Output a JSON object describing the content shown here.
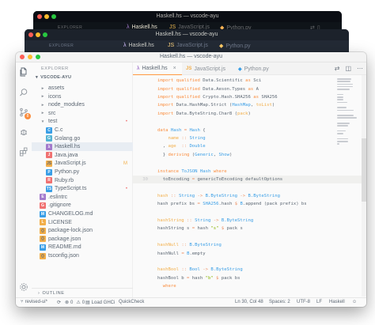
{
  "colors": {
    "accent": "#ff9940",
    "dark_bg": "#0f1419",
    "mirage_bg": "#212733",
    "light_bg": "#fafafa",
    "keyword": "#fa8d3e",
    "type": "#399ee6",
    "string": "#86b300",
    "function": "#f2ae49",
    "constant": "#a37acc",
    "traffic_red": "#ff5f57",
    "traffic_yellow": "#febc2e",
    "traffic_green": "#28c840"
  },
  "bg_window_dark": {
    "title": "Haskell.hs — vscode-ayu",
    "explorer_label": "EXPLORER",
    "tabs": [
      {
        "label": "Haskell.hs",
        "icon": "haskell-file-icon"
      },
      {
        "label": "JavaScript.js",
        "icon": "js-file-icon"
      },
      {
        "label": "Python.py",
        "icon": "python-file-icon"
      }
    ]
  },
  "bg_window_mirage": {
    "title": "Haskell.hs — vscode-ayu",
    "explorer_label": "EXPLORER",
    "tabs": [
      {
        "label": "Haskell.hs",
        "icon": "haskell-file-icon"
      },
      {
        "label": "JavaScript.js",
        "icon": "js-file-icon"
      },
      {
        "label": "Python.py",
        "icon": "python-file-icon"
      }
    ]
  },
  "window": {
    "title": "Haskell.hs — vscode-ayu"
  },
  "activity_bar": {
    "items": [
      "files-icon",
      "search-icon",
      "source-control-icon",
      "debug-icon",
      "extensions-icon"
    ],
    "scm_badge": "8",
    "bottom": "settings-gear-icon"
  },
  "explorer": {
    "header": "EXPLORER",
    "project": "VSCODE-AYU",
    "tree": [
      {
        "name": "assets",
        "type": "folder",
        "depth": 1
      },
      {
        "name": "icons",
        "type": "folder",
        "depth": 1
      },
      {
        "name": "node_modules",
        "type": "folder",
        "depth": 1
      },
      {
        "name": "src",
        "type": "folder",
        "depth": 1
      },
      {
        "name": "test",
        "type": "folder-open",
        "depth": 1,
        "mark": "•"
      },
      {
        "name": "C.c",
        "type": "c",
        "depth": 2
      },
      {
        "name": "Golang.go",
        "type": "go",
        "depth": 2
      },
      {
        "name": "Haskell.hs",
        "type": "hs",
        "depth": 2,
        "selected": true
      },
      {
        "name": "Java.java",
        "type": "java",
        "depth": 2
      },
      {
        "name": "JavaScript.js",
        "type": "js",
        "depth": 2,
        "mark": "M"
      },
      {
        "name": "Python.py",
        "type": "py",
        "depth": 2
      },
      {
        "name": "Ruby.rb",
        "type": "rb",
        "depth": 2
      },
      {
        "name": "TypeScript.ts",
        "type": "ts",
        "depth": 2,
        "mark": "•"
      },
      {
        "name": ".eslintrc",
        "type": "eslint",
        "depth": 1
      },
      {
        "name": ".gitignore",
        "type": "git",
        "depth": 1
      },
      {
        "name": "CHANGELOG.md",
        "type": "md",
        "depth": 1
      },
      {
        "name": "LICENSE",
        "type": "license",
        "depth": 1
      },
      {
        "name": "package-lock.json",
        "type": "json",
        "depth": 1
      },
      {
        "name": "package.json",
        "type": "json",
        "depth": 1
      },
      {
        "name": "README.md",
        "type": "md",
        "depth": 1
      },
      {
        "name": "tsconfig.json",
        "type": "json",
        "depth": 1
      }
    ],
    "outline": "OUTLINE"
  },
  "editor_tabs": [
    {
      "label": "Haskell.hs",
      "icon": "haskell-file-icon",
      "active": true,
      "close": "×"
    },
    {
      "label": "JavaScript.js",
      "icon": "js-file-icon",
      "active": false
    },
    {
      "label": "Python.py",
      "icon": "python-file-icon",
      "active": false
    }
  ],
  "editor_actions": [
    "open-changes-icon",
    "split-editor-icon",
    "more-actions-icon"
  ],
  "code_lines": [
    {
      "n": "",
      "tokens": [
        [
          "k",
          "import qualified "
        ],
        [
          "p",
          "Data.Scientific "
        ],
        [
          "k",
          "as "
        ],
        [
          "p",
          "Sci"
        ]
      ]
    },
    {
      "n": "",
      "tokens": [
        [
          "k",
          "import qualified "
        ],
        [
          "p",
          "Data.Aeson.Types "
        ],
        [
          "k",
          "as "
        ],
        [
          "p",
          "A"
        ]
      ]
    },
    {
      "n": "",
      "tokens": [
        [
          "k",
          "import qualified "
        ],
        [
          "p",
          "Crypto.Hash.SHA256 "
        ],
        [
          "k",
          "as "
        ],
        [
          "p",
          "SHA256"
        ]
      ]
    },
    {
      "n": "",
      "tokens": [
        [
          "k",
          "import "
        ],
        [
          "p",
          "Data.HashMap.Strict ("
        ],
        [
          "t",
          "HashMap"
        ],
        [
          "p",
          ", "
        ],
        [
          "f",
          "toList"
        ],
        [
          "p",
          ")"
        ]
      ]
    },
    {
      "n": "",
      "tokens": [
        [
          "k",
          "import "
        ],
        [
          "p",
          "Data.ByteString.Char8 ("
        ],
        [
          "f",
          "pack"
        ],
        [
          "p",
          ")"
        ]
      ]
    },
    {
      "n": "",
      "tokens": []
    },
    {
      "n": "",
      "tokens": [
        [
          "k",
          "data "
        ],
        [
          "t",
          "Hash "
        ],
        [
          "o",
          "= "
        ],
        [
          "t",
          "Hash "
        ],
        [
          "p",
          "{"
        ]
      ]
    },
    {
      "n": "",
      "tokens": [
        [
          "p",
          "    "
        ],
        [
          "f",
          "name "
        ],
        [
          "o",
          ":: "
        ],
        [
          "t",
          "String"
        ]
      ]
    },
    {
      "n": "",
      "tokens": [
        [
          "p",
          "  , "
        ],
        [
          "f",
          "age  "
        ],
        [
          "o",
          ":: "
        ],
        [
          "t",
          "Double"
        ]
      ]
    },
    {
      "n": "",
      "tokens": [
        [
          "p",
          "  } "
        ],
        [
          "k",
          "deriving "
        ],
        [
          "p",
          "("
        ],
        [
          "t",
          "Generic"
        ],
        [
          "p",
          ", "
        ],
        [
          "t",
          "Show"
        ],
        [
          "p",
          ")"
        ]
      ]
    },
    {
      "n": "",
      "tokens": []
    },
    {
      "n": "",
      "tokens": [
        [
          "k",
          "instance "
        ],
        [
          "t",
          "ToJSON "
        ],
        [
          "t",
          "Hash "
        ],
        [
          "k",
          "where"
        ]
      ]
    },
    {
      "n": "30",
      "current": true,
      "tokens": [
        [
          "p",
          "  toEncoding "
        ],
        [
          "o",
          "= "
        ],
        [
          "p",
          "genericToEncoding defaultOptions"
        ]
      ]
    },
    {
      "n": "",
      "tokens": []
    },
    {
      "n": "",
      "tokens": [
        [
          "f",
          "hash "
        ],
        [
          "o",
          ":: "
        ],
        [
          "t",
          "String "
        ],
        [
          "o",
          "-> "
        ],
        [
          "t",
          "B.ByteString "
        ],
        [
          "o",
          "-> "
        ],
        [
          "t",
          "B.ByteString"
        ]
      ]
    },
    {
      "n": "",
      "tokens": [
        [
          "p",
          "hash prefix bs "
        ],
        [
          "o",
          "= "
        ],
        [
          "t",
          "SHA256"
        ],
        [
          "p",
          ".hash "
        ],
        [
          "o",
          "$ "
        ],
        [
          "t",
          "B"
        ],
        [
          "p",
          ".append (pack prefix) bs"
        ]
      ]
    },
    {
      "n": "",
      "tokens": []
    },
    {
      "n": "",
      "tokens": [
        [
          "f",
          "hashString "
        ],
        [
          "o",
          ":: "
        ],
        [
          "t",
          "String "
        ],
        [
          "o",
          "-> "
        ],
        [
          "t",
          "B.ByteString"
        ]
      ]
    },
    {
      "n": "",
      "tokens": [
        [
          "p",
          "hashString s "
        ],
        [
          "o",
          "= "
        ],
        [
          "p",
          "hash "
        ],
        [
          "s",
          "\"s\" "
        ],
        [
          "o",
          "$ "
        ],
        [
          "p",
          "pack s"
        ]
      ]
    },
    {
      "n": "",
      "tokens": []
    },
    {
      "n": "",
      "tokens": [
        [
          "f",
          "hashNull "
        ],
        [
          "o",
          ":: "
        ],
        [
          "t",
          "B.ByteString"
        ]
      ]
    },
    {
      "n": "",
      "tokens": [
        [
          "p",
          "hashNull "
        ],
        [
          "o",
          "= "
        ],
        [
          "t",
          "B"
        ],
        [
          "p",
          ".empty"
        ]
      ]
    },
    {
      "n": "",
      "tokens": []
    },
    {
      "n": "",
      "tokens": [
        [
          "f",
          "hashBool "
        ],
        [
          "o",
          ":: "
        ],
        [
          "t",
          "Bool "
        ],
        [
          "o",
          "-> "
        ],
        [
          "t",
          "B.ByteString"
        ]
      ]
    },
    {
      "n": "",
      "tokens": [
        [
          "p",
          "hashBool b "
        ],
        [
          "o",
          "= "
        ],
        [
          "p",
          "hash "
        ],
        [
          "s",
          "\"b\" "
        ],
        [
          "o",
          "$ "
        ],
        [
          "p",
          "pack bs"
        ]
      ]
    },
    {
      "n": "",
      "tokens": [
        [
          "k",
          "  where"
        ]
      ]
    }
  ],
  "status_bar": {
    "branch": "revised-ui*",
    "sync": "",
    "errors": "0",
    "warnings": "0",
    "ghci": "Load GHCi",
    "quickcheck": "QuickCheck",
    "position": "Ln 30, Col 48",
    "spaces": "Spaces: 2",
    "encoding": "UTF-8",
    "eol": "LF",
    "language": "Haskell"
  }
}
